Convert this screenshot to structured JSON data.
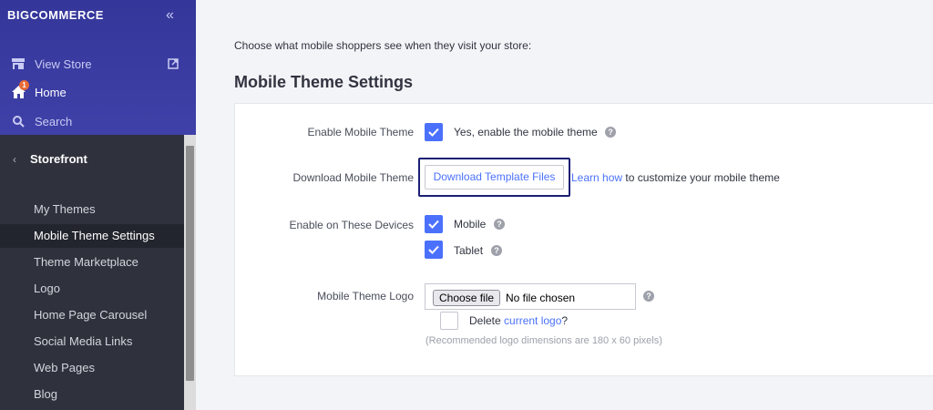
{
  "brand": {
    "logo_text": "COMMERCE",
    "logo_prefix": "BIG"
  },
  "sidebar_top": {
    "view_store": "View Store",
    "home": "Home",
    "home_badge": "1",
    "search": "Search"
  },
  "sidebar": {
    "section_title": "Storefront",
    "items": [
      {
        "label": "My Themes"
      },
      {
        "label": "Mobile Theme Settings"
      },
      {
        "label": "Theme Marketplace"
      },
      {
        "label": "Logo"
      },
      {
        "label": "Home Page Carousel"
      },
      {
        "label": "Social Media Links"
      },
      {
        "label": "Web Pages"
      },
      {
        "label": "Blog"
      }
    ]
  },
  "main": {
    "intro": "Choose what mobile shoppers see when they visit your store:",
    "title": "Mobile Theme Settings",
    "enable_theme": {
      "label": "Enable Mobile Theme",
      "option": "Yes, enable the mobile theme",
      "checked": true
    },
    "download": {
      "label": "Download Mobile Theme",
      "button": "Download Template Files",
      "link": "Learn how",
      "suffix": "to customize your mobile theme"
    },
    "devices": {
      "label": "Enable on These Devices",
      "options": [
        {
          "label": "Mobile",
          "checked": true
        },
        {
          "label": "Tablet",
          "checked": true
        }
      ]
    },
    "logo": {
      "label": "Mobile Theme Logo",
      "choose_button": "Choose file",
      "file_status": "No file chosen",
      "delete_prefix": "Delete",
      "delete_link": "current logo",
      "delete_suffix": "?",
      "hint": "(Recommended logo dimensions are 180 x 60 pixels)"
    }
  },
  "colors": {
    "accent": "#4b71fc",
    "sidebar_top": "#3b3e9e",
    "sidebar": "#313440",
    "highlight": "#1b1f74"
  }
}
